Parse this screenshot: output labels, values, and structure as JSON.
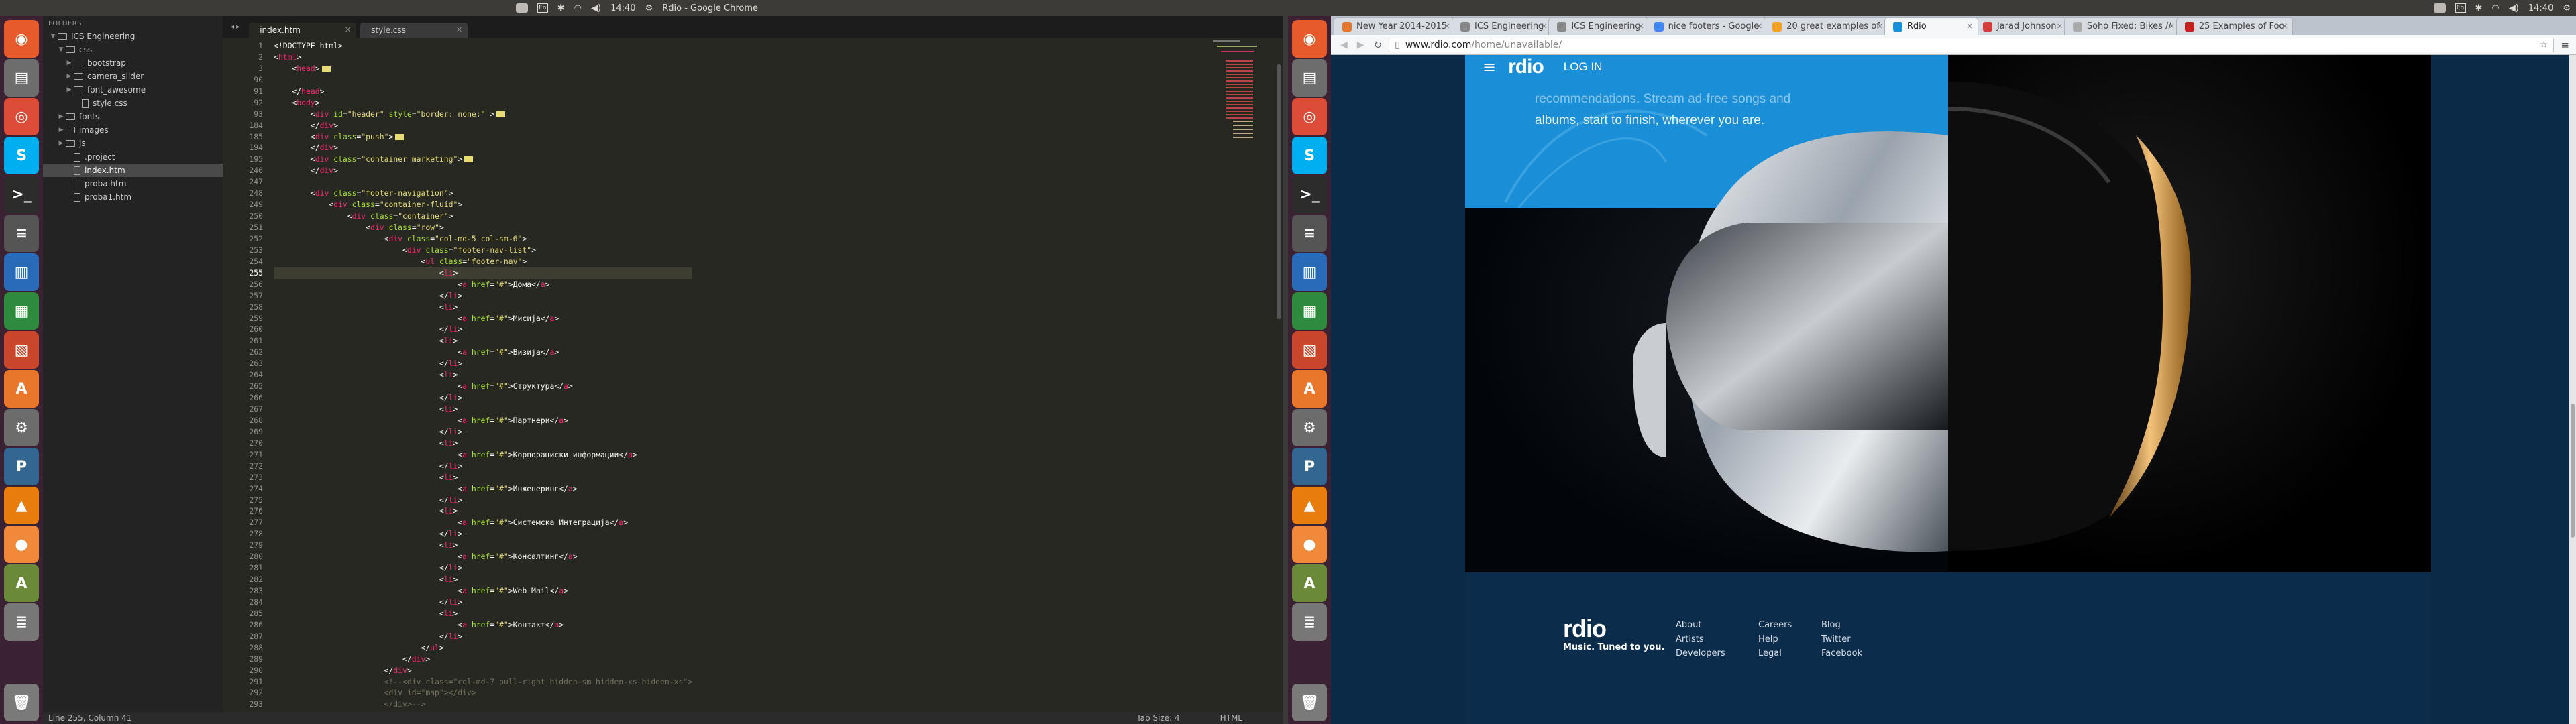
{
  "topbar": {
    "left_title": "Rdio - Google Chrome",
    "left_time": "14:40",
    "right_time": "14:40",
    "tray_icons": [
      "dropbox-icon",
      "keyboard-layout-icon",
      "bluetooth-icon",
      "wifi-icon",
      "volume-icon",
      "time",
      "settings-gear-icon"
    ]
  },
  "launcher": {
    "items": [
      {
        "name": "dash-icon",
        "color": "#e65a2c",
        "glyph": "◉"
      },
      {
        "name": "files-icon",
        "color": "#6d6d6d",
        "glyph": "▤"
      },
      {
        "name": "chrome-icon",
        "color": "#dd4b39",
        "glyph": "◎"
      },
      {
        "name": "skype-icon",
        "color": "#00aff0",
        "glyph": "S"
      },
      {
        "name": "terminal-icon",
        "color": "#2c2c2c",
        "glyph": ">_"
      },
      {
        "name": "sublime-icon",
        "color": "#555",
        "glyph": "≡"
      },
      {
        "name": "writer-icon",
        "color": "#2a6bb8",
        "glyph": "▥"
      },
      {
        "name": "calc-icon",
        "color": "#2e8b3d",
        "glyph": "▦"
      },
      {
        "name": "impress-icon",
        "color": "#c9452b",
        "glyph": "▧"
      },
      {
        "name": "software-center-icon",
        "color": "#e8762b",
        "glyph": "A"
      },
      {
        "name": "system-settings-icon",
        "color": "#6c6c6c",
        "glyph": "⚙"
      },
      {
        "name": "postgres-icon",
        "color": "#336791",
        "glyph": "P"
      },
      {
        "name": "vlc-icon",
        "color": "#e87d0d",
        "glyph": "▲"
      },
      {
        "name": "tomato-icon",
        "color": "#f08a3a",
        "glyph": "●"
      },
      {
        "name": "update-manager-icon",
        "color": "#6a8a3a",
        "glyph": "A"
      },
      {
        "name": "disks-icon",
        "color": "#777",
        "glyph": "≣"
      },
      {
        "name": "trash-icon",
        "color": "#7a7a7a",
        "glyph": "🗑"
      }
    ]
  },
  "sidebar": {
    "header": "FOLDERS",
    "items": [
      {
        "label": "ICS Engineering",
        "type": "folder",
        "depth": 0,
        "open": true
      },
      {
        "label": "css",
        "type": "folder",
        "depth": 1,
        "open": true
      },
      {
        "label": "bootstrap",
        "type": "folder",
        "depth": 2,
        "open": false
      },
      {
        "label": "camera_slider",
        "type": "folder",
        "depth": 2,
        "open": false
      },
      {
        "label": "font_awesome",
        "type": "folder",
        "depth": 2,
        "open": false
      },
      {
        "label": "style.css",
        "type": "file",
        "depth": 3
      },
      {
        "label": "fonts",
        "type": "folder",
        "depth": 1,
        "open": false
      },
      {
        "label": "images",
        "type": "folder",
        "depth": 1,
        "open": false
      },
      {
        "label": "js",
        "type": "folder",
        "depth": 1,
        "open": false
      },
      {
        "label": ".project",
        "type": "file",
        "depth": 2
      },
      {
        "label": "index.htm",
        "type": "file",
        "depth": 2,
        "selected": true
      },
      {
        "label": "proba.htm",
        "type": "file",
        "depth": 2
      },
      {
        "label": "proba1.htm",
        "type": "file",
        "depth": 2
      }
    ]
  },
  "editor": {
    "tabs": [
      {
        "label": "index.htm",
        "active": true
      },
      {
        "label": "style.css",
        "active": false
      }
    ],
    "lines": [
      {
        "n": "1",
        "html": "<span class='tx'>&lt;!DOCTYPE html&gt;</span>"
      },
      {
        "n": "2",
        "html": "<span class='tx'>&lt;</span><span class='tg'>html</span><span class='tx'>&gt;</span>"
      },
      {
        "n": "3",
        "html": "    <span class='tx'>&lt;</span><span class='tg'>head</span><span class='tx'>&gt;</span><span class='fold-mark'></span>"
      },
      {
        "n": "90",
        "html": ""
      },
      {
        "n": "91",
        "html": "    <span class='tx'>&lt;/</span><span class='tg'>head</span><span class='tx'>&gt;</span>"
      },
      {
        "n": "92",
        "html": "    <span class='tx'>&lt;</span><span class='tg'>body</span><span class='tx'>&gt;</span>"
      },
      {
        "n": "93",
        "html": "        <span class='tx'>&lt;</span><span class='tg'>div</span> <span class='at'>id</span><span class='tx'>=</span><span class='st'>\"header\"</span> <span class='at'>style</span><span class='tx'>=</span><span class='st'>\"border: none;\"</span> <span class='tx'>&gt;</span><span class='fold-mark'></span>"
      },
      {
        "n": "184",
        "html": "        <span class='tx'>&lt;/</span><span class='tg'>div</span><span class='tx'>&gt;</span>"
      },
      {
        "n": "185",
        "html": "        <span class='tx'>&lt;</span><span class='tg'>div</span> <span class='at'>class</span><span class='tx'>=</span><span class='st'>\"push\"</span><span class='tx'>&gt;</span><span class='fold-mark'></span>"
      },
      {
        "n": "194",
        "html": "        <span class='tx'>&lt;/</span><span class='tg'>div</span><span class='tx'>&gt;</span>"
      },
      {
        "n": "195",
        "html": "        <span class='tx'>&lt;</span><span class='tg'>div</span> <span class='at'>class</span><span class='tx'>=</span><span class='st'>\"container marketing\"</span><span class='tx'>&gt;</span><span class='fold-mark'></span>"
      },
      {
        "n": "246",
        "html": "        <span class='tx'>&lt;/</span><span class='tg'>div</span><span class='tx'>&gt;</span>"
      },
      {
        "n": "247",
        "html": ""
      },
      {
        "n": "248",
        "html": "        <span class='tx'>&lt;</span><span class='tg'>div</span> <span class='at'>class</span><span class='tx'>=</span><span class='st'>\"footer-navigation\"</span><span class='tx'>&gt;</span>"
      },
      {
        "n": "249",
        "html": "            <span class='tx'>&lt;</span><span class='tg'>div</span> <span class='at'>class</span><span class='tx'>=</span><span class='st'>\"container-fluid\"</span><span class='tx'>&gt;</span>"
      },
      {
        "n": "250",
        "html": "                <span class='tx'>&lt;</span><span class='tg'>div</span> <span class='at'>class</span><span class='tx'>=</span><span class='st'>\"container\"</span><span class='tx'>&gt;</span>"
      },
      {
        "n": "251",
        "html": "                    <span class='tx'>&lt;</span><span class='tg'>div</span> <span class='at'>class</span><span class='tx'>=</span><span class='st'>\"row\"</span><span class='tx'>&gt;</span>"
      },
      {
        "n": "252",
        "html": "                        <span class='tx'>&lt;</span><span class='tg'>div</span> <span class='at'>class</span><span class='tx'>=</span><span class='st'>\"col-md-5 col-sm-6\"</span><span class='tx'>&gt;</span>"
      },
      {
        "n": "253",
        "html": "                            <span class='tx'>&lt;</span><span class='tg'>div</span> <span class='at'>class</span><span class='tx'>=</span><span class='st'>\"footer-nav-list\"</span><span class='tx'>&gt;</span>"
      },
      {
        "n": "254",
        "html": "                                <span class='tx'>&lt;</span><span class='tg'>ul</span> <span class='at'>class</span><span class='tx'>=</span><span class='st'>\"footer-nav\"</span><span class='tx'>&gt;</span>"
      },
      {
        "n": "255",
        "html": "                                    <span class='tx'>&lt;</span><span class='tg'>li</span><span class='tx'>&gt;</span>"
      },
      {
        "n": "256",
        "html": "                                        <span class='tx'>&lt;</span><span class='tg'>a</span> <span class='at'>href</span><span class='tx'>=</span><span class='st'>\"#\"</span><span class='tx'>&gt;Дома&lt;/</span><span class='tg'>a</span><span class='tx'>&gt;</span>"
      },
      {
        "n": "257",
        "html": "                                    <span class='tx'>&lt;/</span><span class='tg'>li</span><span class='tx'>&gt;</span>"
      },
      {
        "n": "258",
        "html": "                                    <span class='tx'>&lt;</span><span class='tg'>li</span><span class='tx'>&gt;</span>"
      },
      {
        "n": "259",
        "html": "                                        <span class='tx'>&lt;</span><span class='tg'>a</span> <span class='at'>href</span><span class='tx'>=</span><span class='st'>\"#\"</span><span class='tx'>&gt;Мисија&lt;/</span><span class='tg'>a</span><span class='tx'>&gt;</span>"
      },
      {
        "n": "260",
        "html": "                                    <span class='tx'>&lt;/</span><span class='tg'>li</span><span class='tx'>&gt;</span>"
      },
      {
        "n": "261",
        "html": "                                    <span class='tx'>&lt;</span><span class='tg'>li</span><span class='tx'>&gt;</span>"
      },
      {
        "n": "262",
        "html": "                                        <span class='tx'>&lt;</span><span class='tg'>a</span> <span class='at'>href</span><span class='tx'>=</span><span class='st'>\"#\"</span><span class='tx'>&gt;Визија&lt;/</span><span class='tg'>a</span><span class='tx'>&gt;</span>"
      },
      {
        "n": "263",
        "html": "                                    <span class='tx'>&lt;/</span><span class='tg'>li</span><span class='tx'>&gt;</span>"
      },
      {
        "n": "264",
        "html": "                                    <span class='tx'>&lt;</span><span class='tg'>li</span><span class='tx'>&gt;</span>"
      },
      {
        "n": "265",
        "html": "                                        <span class='tx'>&lt;</span><span class='tg'>a</span> <span class='at'>href</span><span class='tx'>=</span><span class='st'>\"#\"</span><span class='tx'>&gt;Структура&lt;/</span><span class='tg'>a</span><span class='tx'>&gt;</span>"
      },
      {
        "n": "266",
        "html": "                                    <span class='tx'>&lt;/</span><span class='tg'>li</span><span class='tx'>&gt;</span>"
      },
      {
        "n": "267",
        "html": "                                    <span class='tx'>&lt;</span><span class='tg'>li</span><span class='tx'>&gt;</span>"
      },
      {
        "n": "268",
        "html": "                                        <span class='tx'>&lt;</span><span class='tg'>a</span> <span class='at'>href</span><span class='tx'>=</span><span class='st'>\"#\"</span><span class='tx'>&gt;Партнери&lt;/</span><span class='tg'>a</span><span class='tx'>&gt;</span>"
      },
      {
        "n": "269",
        "html": "                                    <span class='tx'>&lt;/</span><span class='tg'>li</span><span class='tx'>&gt;</span>"
      },
      {
        "n": "270",
        "html": "                                    <span class='tx'>&lt;</span><span class='tg'>li</span><span class='tx'>&gt;</span>"
      },
      {
        "n": "271",
        "html": "                                        <span class='tx'>&lt;</span><span class='tg'>a</span> <span class='at'>href</span><span class='tx'>=</span><span class='st'>\"#\"</span><span class='tx'>&gt;Корпорациски информации&lt;/</span><span class='tg'>a</span><span class='tx'>&gt;</span>"
      },
      {
        "n": "272",
        "html": "                                    <span class='tx'>&lt;/</span><span class='tg'>li</span><span class='tx'>&gt;</span>"
      },
      {
        "n": "273",
        "html": "                                    <span class='tx'>&lt;</span><span class='tg'>li</span><span class='tx'>&gt;</span>"
      },
      {
        "n": "274",
        "html": "                                        <span class='tx'>&lt;</span><span class='tg'>a</span> <span class='at'>href</span><span class='tx'>=</span><span class='st'>\"#\"</span><span class='tx'>&gt;Инженеринг&lt;/</span><span class='tg'>a</span><span class='tx'>&gt;</span>"
      },
      {
        "n": "275",
        "html": "                                    <span class='tx'>&lt;/</span><span class='tg'>li</span><span class='tx'>&gt;</span>"
      },
      {
        "n": "276",
        "html": "                                    <span class='tx'>&lt;</span><span class='tg'>li</span><span class='tx'>&gt;</span>"
      },
      {
        "n": "277",
        "html": "                                        <span class='tx'>&lt;</span><span class='tg'>a</span> <span class='at'>href</span><span class='tx'>=</span><span class='st'>\"#\"</span><span class='tx'>&gt;Системска Интеграција&lt;/</span><span class='tg'>a</span><span class='tx'>&gt;</span>"
      },
      {
        "n": "278",
        "html": "                                    <span class='tx'>&lt;/</span><span class='tg'>li</span><span class='tx'>&gt;</span>"
      },
      {
        "n": "279",
        "html": "                                    <span class='tx'>&lt;</span><span class='tg'>li</span><span class='tx'>&gt;</span>"
      },
      {
        "n": "280",
        "html": "                                        <span class='tx'>&lt;</span><span class='tg'>a</span> <span class='at'>href</span><span class='tx'>=</span><span class='st'>\"#\"</span><span class='tx'>&gt;Консалтинг&lt;/</span><span class='tg'>a</span><span class='tx'>&gt;</span>"
      },
      {
        "n": "281",
        "html": "                                    <span class='tx'>&lt;/</span><span class='tg'>li</span><span class='tx'>&gt;</span>"
      },
      {
        "n": "282",
        "html": "                                    <span class='tx'>&lt;</span><span class='tg'>li</span><span class='tx'>&gt;</span>"
      },
      {
        "n": "283",
        "html": "                                        <span class='tx'>&lt;</span><span class='tg'>a</span> <span class='at'>href</span><span class='tx'>=</span><span class='st'>\"#\"</span><span class='tx'>&gt;Web Mail&lt;/</span><span class='tg'>a</span><span class='tx'>&gt;</span>"
      },
      {
        "n": "284",
        "html": "                                    <span class='tx'>&lt;/</span><span class='tg'>li</span><span class='tx'>&gt;</span>"
      },
      {
        "n": "285",
        "html": "                                    <span class='tx'>&lt;</span><span class='tg'>li</span><span class='tx'>&gt;</span>"
      },
      {
        "n": "286",
        "html": "                                        <span class='tx'>&lt;</span><span class='tg'>a</span> <span class='at'>href</span><span class='tx'>=</span><span class='st'>\"#\"</span><span class='tx'>&gt;Контакт&lt;/</span><span class='tg'>a</span><span class='tx'>&gt;</span>"
      },
      {
        "n": "287",
        "html": "                                    <span class='tx'>&lt;/</span><span class='tg'>li</span><span class='tx'>&gt;</span>"
      },
      {
        "n": "288",
        "html": "                                <span class='tx'>&lt;/</span><span class='tg'>ul</span><span class='tx'>&gt;</span>"
      },
      {
        "n": "289",
        "html": "                            <span class='tx'>&lt;/</span><span class='tg'>div</span><span class='tx'>&gt;</span>"
      },
      {
        "n": "290",
        "html": "                        <span class='tx'>&lt;/</span><span class='tg'>div</span><span class='tx'>&gt;</span>"
      },
      {
        "n": "291",
        "html": "                        <span class='cm'>&lt;!--&lt;div class=\"col-md-7 pull-right hidden-sm hidden-xs hidden-xs\"&gt;</span>"
      },
      {
        "n": "292",
        "html": "                        <span class='cm'>&lt;div id=\"map\"&gt;&lt;/div&gt;</span>"
      },
      {
        "n": "293",
        "html": "                        <span class='cm'>&lt;/div&gt;--&gt;</span>"
      }
    ],
    "status_left": "Line 255, Column 41",
    "status_tab_size": "Tab Size: 4",
    "status_syntax": "HTML"
  },
  "browser": {
    "tabs": [
      {
        "label": "New Year 2014-2015",
        "fav": "#e8762b",
        "active": false
      },
      {
        "label": "ICS Engineering",
        "fav": "#888888",
        "active": false
      },
      {
        "label": "ICS Engineering",
        "fav": "#888888",
        "active": false
      },
      {
        "label": "nice footers - Google",
        "fav": "#4285f4",
        "active": false
      },
      {
        "label": "20 great examples of",
        "fav": "#f4a024",
        "active": false
      },
      {
        "label": "Rdio",
        "fav": "#1a8fd8",
        "active": true
      },
      {
        "label": "Jarad Johnson",
        "fav": "#d63b3b",
        "active": false
      },
      {
        "label": "Soho Fixed: Bikes //",
        "fav": "#aaaaaa",
        "active": false
      },
      {
        "label": "25 Examples of Foo",
        "fav": "#c42020",
        "active": false
      }
    ],
    "url_host": "www.rdio.com",
    "url_path": "/home/unavailable/",
    "page": {
      "nav_login": "LOG IN",
      "logo": "rdio",
      "hero_text_line1": "recommendations. Stream ad-free songs and",
      "hero_text_line2": "albums, start to finish, wherever you are.",
      "footer_logo": "rdio",
      "footer_tagline": "Music. Tuned to you.",
      "footer_cols": [
        [
          "About",
          "Artists",
          "Developers"
        ],
        [
          "Careers",
          "Help",
          "Legal"
        ],
        [
          "Blog",
          "Twitter",
          "Facebook"
        ]
      ],
      "colors": {
        "blue": "#1a8fd8",
        "navy": "#0a2a48"
      }
    }
  }
}
